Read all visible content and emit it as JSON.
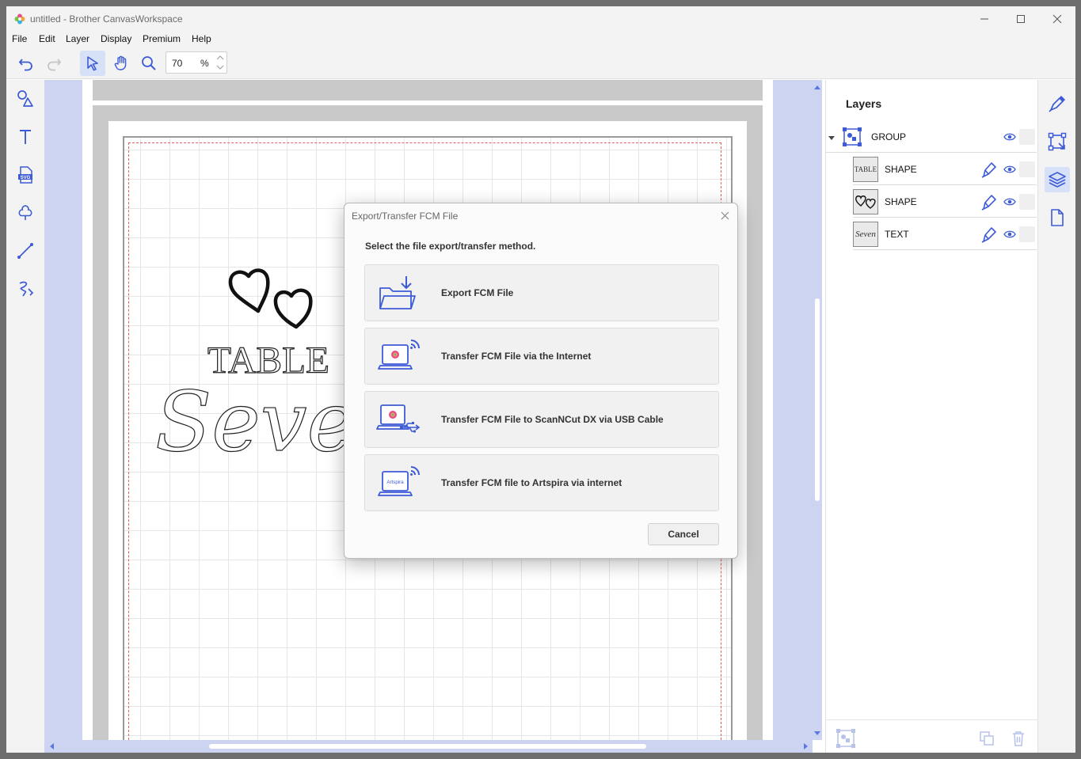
{
  "window": {
    "title": "untitled - Brother CanvasWorkspace"
  },
  "menu": [
    "File",
    "Edit",
    "Layer",
    "Display",
    "Premium",
    "Help"
  ],
  "toolbar": {
    "zoom_value": "70",
    "zoom_unit": "%"
  },
  "artwork": {
    "line1": "TABLE",
    "line2": "Seven"
  },
  "layers": {
    "title": "Layers",
    "items": [
      {
        "label": "GROUP",
        "thumb": "group"
      },
      {
        "label": "SHAPE",
        "thumb": "TABLE"
      },
      {
        "label": "SHAPE",
        "thumb": "hearts"
      },
      {
        "label": "TEXT",
        "thumb": "Seven"
      }
    ]
  },
  "dialog": {
    "title": "Export/Transfer FCM File",
    "prompt": "Select the file export/transfer method.",
    "options": [
      {
        "label": "Export FCM File",
        "icon": "folder-download-icon"
      },
      {
        "label": "Transfer FCM File via the Internet",
        "icon": "laptop-wifi-icon"
      },
      {
        "label": "Transfer FCM File to ScanNCut DX via USB Cable",
        "icon": "laptop-usb-icon"
      },
      {
        "label": "Transfer FCM file to Artspira via internet",
        "icon": "laptop-artspira-icon",
        "screen_text": "Artspira"
      }
    ],
    "cancel_label": "Cancel"
  },
  "colors": {
    "accent": "#3d5bd6",
    "canvas_bg": "#cdd4f1",
    "active_bg": "#d6e0f7"
  }
}
